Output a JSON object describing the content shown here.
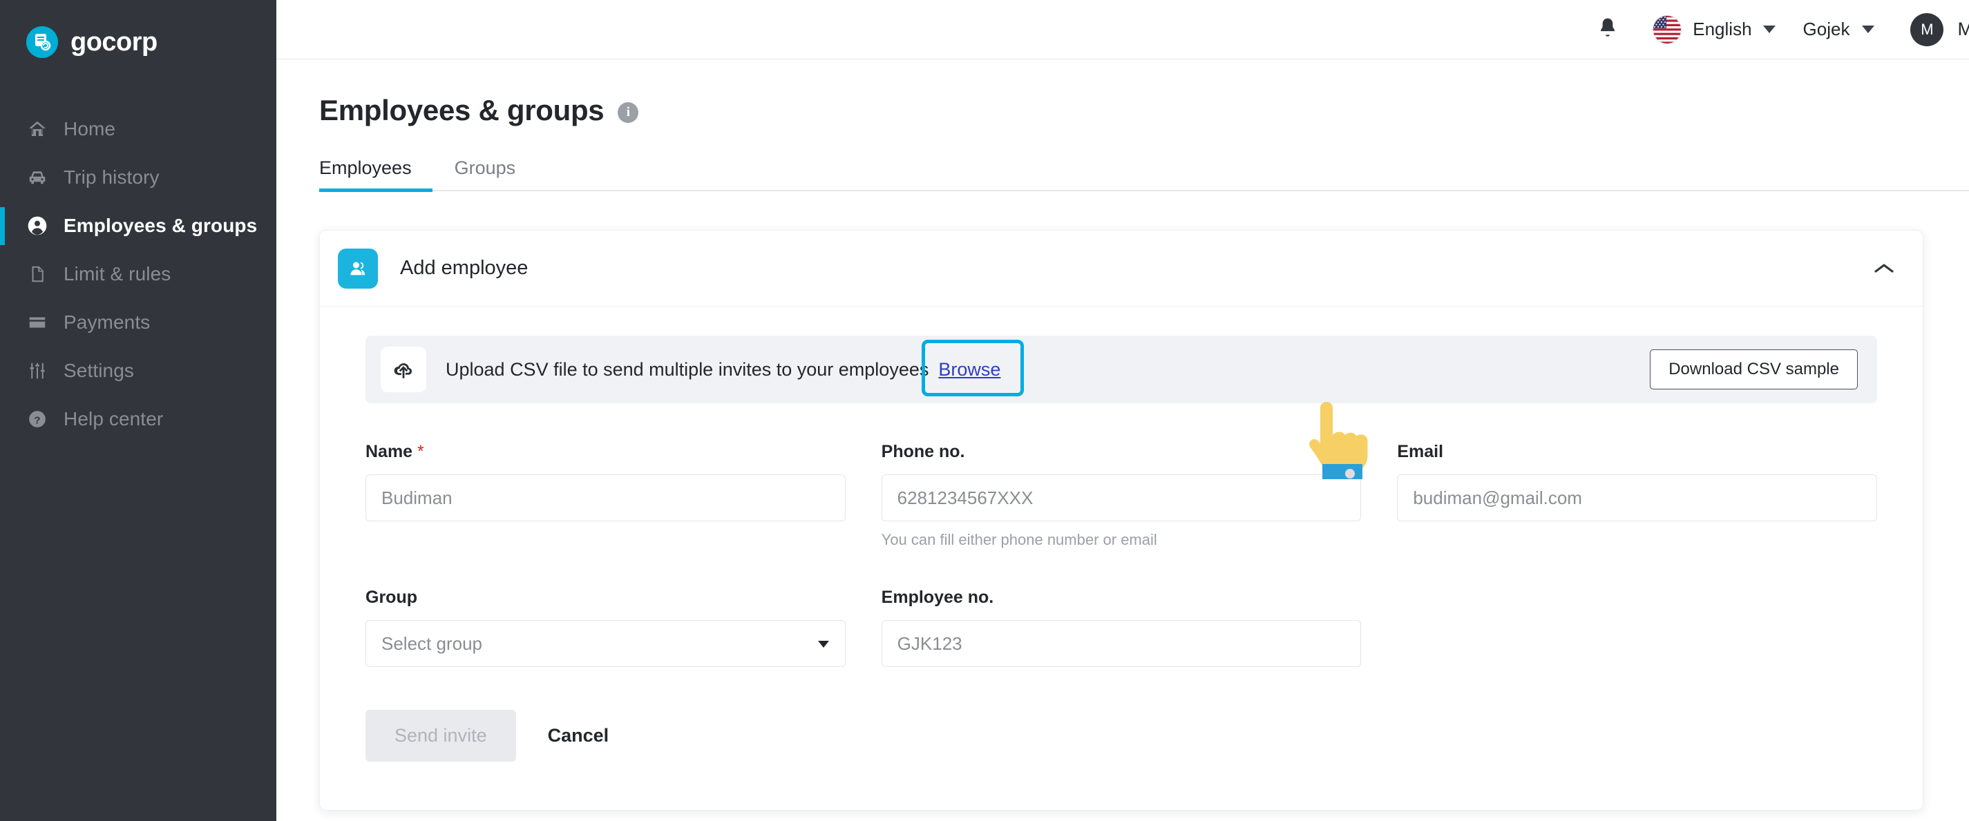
{
  "sidebar": {
    "brand": "gocorp",
    "items": [
      {
        "label": "Home",
        "icon": "home-icon",
        "active": false
      },
      {
        "label": "Trip history",
        "icon": "car-icon",
        "active": false
      },
      {
        "label": "Employees & groups",
        "icon": "user-circle-icon",
        "active": true
      },
      {
        "label": "Limit & rules",
        "icon": "document-icon",
        "active": false
      },
      {
        "label": "Payments",
        "icon": "credit-card-icon",
        "active": false
      },
      {
        "label": "Settings",
        "icon": "sliders-icon",
        "active": false
      },
      {
        "label": "Help center",
        "icon": "question-circle-icon",
        "active": false
      }
    ]
  },
  "topbar": {
    "notifications_icon": "bell-icon",
    "language": "English",
    "language_flag": "us-flag-icon",
    "company": "Gojek",
    "user_initial": "M",
    "user_name": "Mitsalina"
  },
  "page": {
    "title": "Employees & groups",
    "info_icon": "info-icon",
    "info_glyph": "i"
  },
  "tabs": [
    {
      "label": "Employees",
      "active": true
    },
    {
      "label": "Groups",
      "active": false
    }
  ],
  "card": {
    "title": "Add employee",
    "icon": "employee-avatar-icon",
    "collapse_icon": "chevron-up-icon"
  },
  "upload": {
    "icon": "cloud-upload-icon",
    "text": "Upload CSV file to send multiple invites to your employees",
    "browse_label": "Browse",
    "download_sample_label": "Download CSV sample"
  },
  "form": {
    "name": {
      "label": "Name",
      "required_mark": "*",
      "value": "",
      "placeholder": "Budiman"
    },
    "phone": {
      "label": "Phone no.",
      "value": "",
      "placeholder": "6281234567XXX",
      "helper": "You can fill either phone number or email"
    },
    "email": {
      "label": "Email",
      "value": "",
      "placeholder": "budiman@gmail.com"
    },
    "group": {
      "label": "Group",
      "value": "",
      "placeholder": "Select group",
      "options": [
        "Select group"
      ]
    },
    "employee_no": {
      "label": "Employee no.",
      "value": "",
      "placeholder": "GJK123"
    },
    "submit_label": "Send invite",
    "cancel_label": "Cancel"
  },
  "colors": {
    "accent": "#00AED6",
    "sidebar_bg": "#32363C",
    "card_icon": "#1BB4DF",
    "link": "#2F3EC8",
    "highlight_box": "#00ADE3",
    "required": "#E02020"
  }
}
